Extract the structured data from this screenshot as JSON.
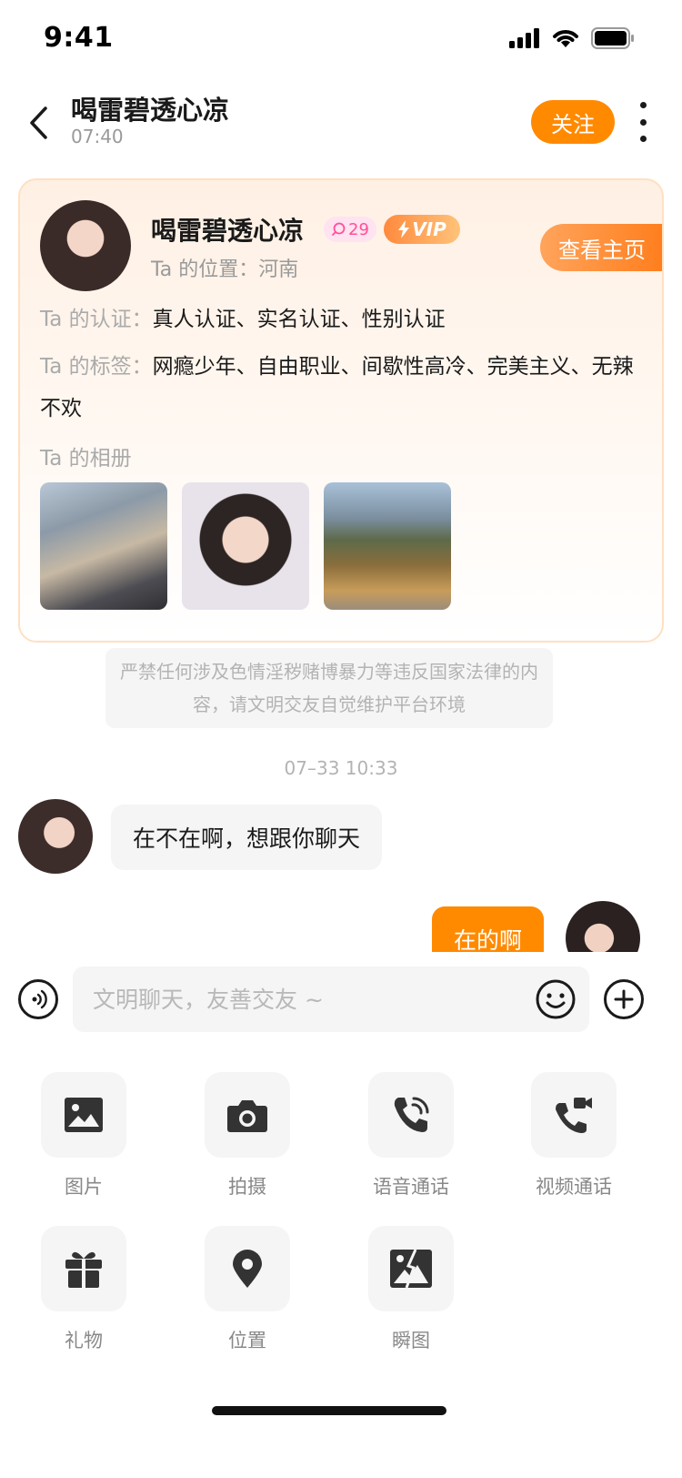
{
  "status_bar": {
    "time": "9:41"
  },
  "nav": {
    "title": "喝雷碧透心凉",
    "subtitle": "07:40",
    "follow_label": "关注"
  },
  "profile": {
    "name": "喝雷碧透心凉",
    "level": "29",
    "vip": "VIP",
    "location_label": "Ta 的位置：",
    "location": "河南",
    "visit_label": "查看主页",
    "cert_label": "Ta 的认证：",
    "certs": "真人认证、实名认证、性别认证",
    "tags_label": "Ta 的标签：",
    "tags": "网瘾少年、自由职业、间歇性高冷、完美主义、无辣不欢",
    "album_label": "Ta 的相册"
  },
  "notice": "严禁任何涉及色情淫秽赌博暴力等违反国家法律的内容，请文明交友自觉维护平台环境",
  "timestamp": "07–33 10:33",
  "messages": [
    {
      "side": "left",
      "text": "在不在啊，想跟你聊天"
    },
    {
      "side": "right",
      "text": "在的啊"
    }
  ],
  "input": {
    "placeholder": "文明聊天，友善交友 ~"
  },
  "tools": [
    {
      "label": "图片",
      "icon": "image-icon"
    },
    {
      "label": "拍摄",
      "icon": "camera-icon"
    },
    {
      "label": "语音通话",
      "icon": "voice-call-icon"
    },
    {
      "label": "视频通话",
      "icon": "video-call-icon"
    },
    {
      "label": "礼物",
      "icon": "gift-icon"
    },
    {
      "label": "位置",
      "icon": "location-icon"
    },
    {
      "label": "瞬图",
      "icon": "flash-image-icon"
    }
  ],
  "colors": {
    "accent": "#ff8a00",
    "vip_gradient": "#ff8a3d",
    "level_badge": "#ff4f9a"
  }
}
